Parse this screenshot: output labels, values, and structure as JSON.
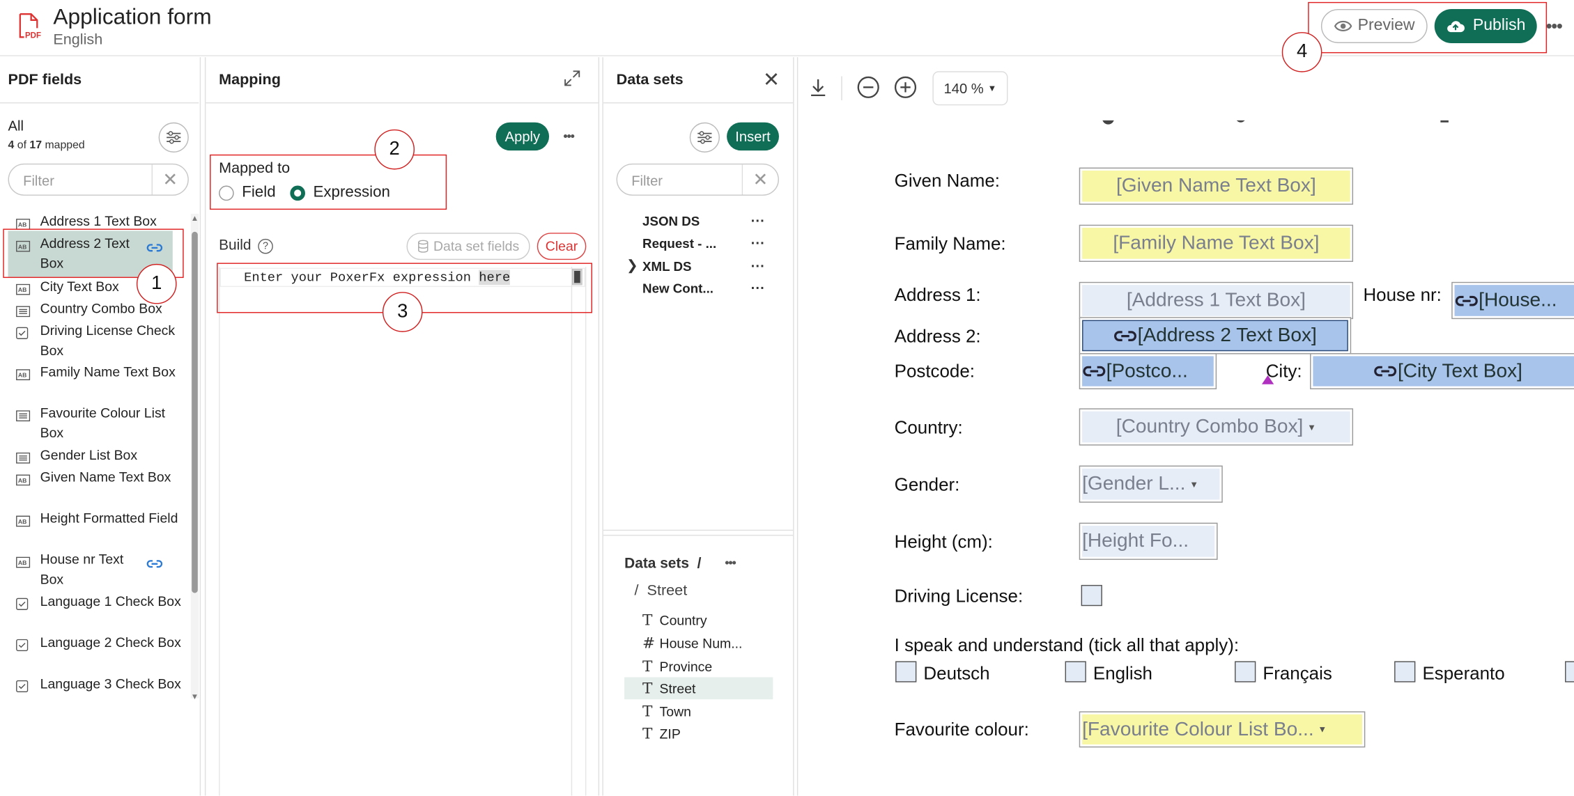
{
  "header": {
    "title": "Application form",
    "subtitle": "English",
    "preview_label": "Preview",
    "publish_label": "Publish"
  },
  "callouts": [
    "1",
    "2",
    "3",
    "4"
  ],
  "pdf_fields": {
    "title": "PDF fields",
    "group": "All",
    "count_mapped": "4",
    "count_of": "of",
    "count_total": "17",
    "count_suffix": "mapped",
    "filter_placeholder": "Filter",
    "items": [
      {
        "label": "Address 1 Text Box",
        "icon": "text-box-icon",
        "linked": false
      },
      {
        "label": "Address 2 Text Box",
        "icon": "text-box-icon",
        "linked": true
      },
      {
        "label": "City Text Box",
        "icon": "text-box-icon",
        "linked": false
      },
      {
        "label": "Country Combo Box",
        "icon": "list-box-icon",
        "linked": false
      },
      {
        "label": "Driving License Check Box",
        "icon": "check-box-icon",
        "linked": false
      },
      {
        "label": "Family Name Text Box",
        "icon": "text-box-icon",
        "linked": false
      },
      {
        "label": "Favourite Colour List Box",
        "icon": "list-box-icon",
        "linked": false
      },
      {
        "label": "Gender List Box",
        "icon": "list-box-icon",
        "linked": false
      },
      {
        "label": "Given Name Text Box",
        "icon": "text-box-icon",
        "linked": false
      },
      {
        "label": "Height Formatted Field",
        "icon": "text-box-icon",
        "linked": false
      },
      {
        "label": "House nr Text Box",
        "icon": "text-box-icon",
        "linked": true
      },
      {
        "label": "Language 1 Check Box",
        "icon": "check-box-icon",
        "linked": false
      },
      {
        "label": "Language 2 Check Box",
        "icon": "check-box-icon",
        "linked": false
      },
      {
        "label": "Language 3 Check Box",
        "icon": "check-box-icon",
        "linked": false
      }
    ]
  },
  "mapping": {
    "title": "Mapping",
    "apply_label": "Apply",
    "mapped_to_label": "Mapped to",
    "option_field": "Field",
    "option_expression": "Expression",
    "selected_option": "Expression",
    "build_label": "Build",
    "data_set_fields_label": "Data set fields",
    "clear_label": "Clear",
    "code_text": "Enter your PoxerFx expression ",
    "code_highlight": "here"
  },
  "datasets": {
    "title": "Data sets",
    "insert_label": "Insert",
    "filter_placeholder": "Filter",
    "items": [
      "JSON DS",
      "Request - ...",
      "XML DS",
      "New Cont..."
    ],
    "breadcrumb_root": "Data sets",
    "breadcrumb_sep": "/",
    "path_sep": "/",
    "path": "Street",
    "fields": [
      {
        "name": "Country",
        "type": "text"
      },
      {
        "name": "House Num...",
        "type": "number"
      },
      {
        "name": "Province",
        "type": "text"
      },
      {
        "name": "Street",
        "type": "text"
      },
      {
        "name": "Town",
        "type": "text"
      },
      {
        "name": "ZIP",
        "type": "text"
      }
    ],
    "selected_field": "Street"
  },
  "preview": {
    "zoom": "140 %",
    "labels": {
      "given": "Given Name:",
      "family": "Family Name:",
      "addr1": "Address 1:",
      "house": "House nr:",
      "addr2": "Address 2:",
      "postcode": "Postcode:",
      "city": "City:",
      "country": "Country:",
      "gender": "Gender:",
      "height": "Height (cm):",
      "driving": "Driving License:",
      "speak": "I speak and understand (tick all that apply):",
      "colour": "Favourite colour:"
    },
    "fields": {
      "given": "[Given Name Text Box]",
      "family": "[Family Name Text Box]",
      "addr1": "[Address 1 Text Box]",
      "house": "[House...",
      "addr2": "[Address 2 Text Box]",
      "postcode": "[Postco...",
      "city": "[City Text Box]",
      "country": "[Country Combo Box]",
      "gender": "[Gender L...",
      "height": "[Height Fo...",
      "colour": "[Favourite Colour List Bo..."
    },
    "languages": [
      "Deutsch",
      "English",
      "Français",
      "Esperanto"
    ]
  },
  "colors": {
    "accent": "#0f6e55",
    "callout_red": "#e02020",
    "selected_row": "#c8d8d2",
    "yellow_field": "#f8f7a5",
    "linked_field": "#a9c4ea"
  }
}
